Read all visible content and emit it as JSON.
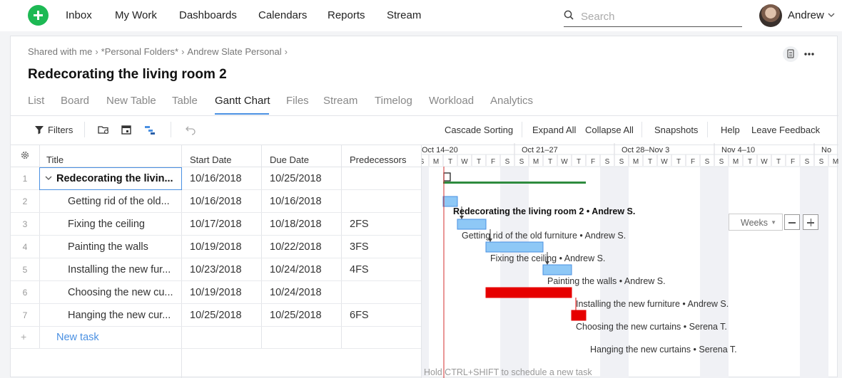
{
  "nav": {
    "items": [
      "Inbox",
      "My Work",
      "Dashboards",
      "Calendars",
      "Reports",
      "Stream"
    ],
    "search_placeholder": "Search",
    "user_name": "Andrew"
  },
  "project": {
    "breadcrumbs": [
      "Shared with me",
      "*Personal Folders*",
      "Andrew Slate Personal"
    ],
    "title": "Redecorating the living room 2",
    "tabs": [
      "List",
      "Board",
      "New Table",
      "Table",
      "Gantt Chart",
      "Files",
      "Stream",
      "Timelog",
      "Workload",
      "Analytics"
    ],
    "active_tab": "Gantt Chart"
  },
  "toolbar": {
    "filters_label": "Filters",
    "right_actions": [
      "Cascade Sorting",
      "Expand All",
      "Collapse All",
      "Snapshots",
      "Help",
      "Leave Feedback"
    ]
  },
  "grid": {
    "columns": [
      "Title",
      "Start Date",
      "Due Date",
      "Predecessors"
    ],
    "rows": [
      {
        "num": "1",
        "title": "Redecorating the livin...",
        "start": "10/16/2018",
        "due": "10/25/2018",
        "pred": ""
      },
      {
        "num": "2",
        "title": "Getting rid of the old...",
        "start": "10/16/2018",
        "due": "10/16/2018",
        "pred": ""
      },
      {
        "num": "3",
        "title": "Fixing the ceiling",
        "start": "10/17/2018",
        "due": "10/18/2018",
        "pred": "2FS"
      },
      {
        "num": "4",
        "title": "Painting the walls",
        "start": "10/19/2018",
        "due": "10/22/2018",
        "pred": "3FS"
      },
      {
        "num": "5",
        "title": "Installing the new fur...",
        "start": "10/23/2018",
        "due": "10/24/2018",
        "pred": "4FS"
      },
      {
        "num": "6",
        "title": "Choosing the new cu...",
        "start": "10/19/2018",
        "due": "10/24/2018",
        "pred": ""
      },
      {
        "num": "7",
        "title": "Hanging the new cur...",
        "start": "10/25/2018",
        "due": "10/25/2018",
        "pred": "6FS"
      }
    ],
    "new_task_label": "New task",
    "new_task_plus": "+"
  },
  "gantt": {
    "weeks": [
      "Oct 14–20",
      "Oct 21–27",
      "Oct 28–Nov 3",
      "Nov 4–10",
      "No"
    ],
    "day_letters": [
      "S",
      "M",
      "T",
      "W",
      "T",
      "F",
      "S"
    ],
    "bar_labels": [
      "Redecorating the living room 2 • Andrew S.",
      "Getting rid of the old furniture • Andrew S.",
      "Fixing the ceiling • Andrew S.",
      "Painting the walls • Andrew S.",
      "Installing the new furniture • Andrew S.",
      "Choosing the new curtains • Serena T.",
      "Hanging the new curtains • Serena T."
    ],
    "hint": "Hold CTRL+SHIFT to schedule a new task",
    "scale_label": "Weeks",
    "colors": {
      "task": "#8ec8f6",
      "task_border": "#4a90e2",
      "highlight": "#e60000",
      "summary": "#2e8b3e",
      "today": "#d32f2f",
      "weekend": "#f0f1f5"
    }
  }
}
